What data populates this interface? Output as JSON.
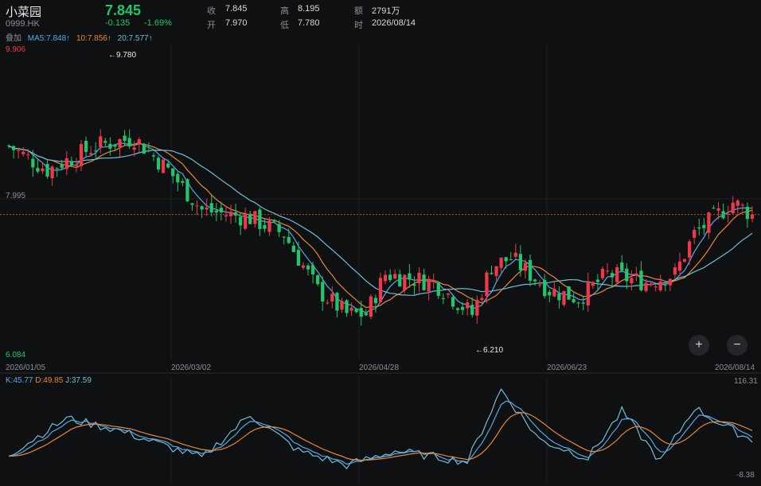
{
  "header": {
    "name": "小菜园",
    "code": "0999.HK",
    "price": "7.845",
    "change": "-0.135",
    "change_pct": "-1.69%",
    "close_label": "收",
    "close_value": "7.845",
    "open_label": "开",
    "open_value": "7.970",
    "high_label": "高",
    "high_value": "8.195",
    "low_label": "低",
    "low_value": "7.780",
    "amount_label": "额",
    "amount_value": "2791万",
    "time_label": "时",
    "time_value": "2026/08/14"
  },
  "ma_row": {
    "overlay_label": "叠加",
    "ma5": "MA5:7.848↑",
    "ma10": "10:7.856↑",
    "ma20": "20:7.577↑"
  },
  "price_axis": {
    "top": "9.906",
    "mid": "7.995",
    "bottom": "6.084",
    "max_marker": "←9.780",
    "min_marker": "←6.210"
  },
  "date_axis": [
    "2026/01/05",
    "2026/03/02",
    "2026/04/28",
    "2026/06/23",
    "2026/08/14"
  ],
  "kdj": {
    "k": "K:45.77",
    "d": "D:49.85",
    "j": "J:37.59",
    "top": "116.31",
    "bottom": "-8.38"
  },
  "controls": {
    "zoom_in": "+",
    "zoom_out": "−"
  },
  "colors": {
    "up": "#f0384a",
    "down": "#1fc66b",
    "ma5": "#5aa7e6",
    "ma10": "#e8873b",
    "ma20": "#6fbfd6",
    "k": "#5aa7e6",
    "d": "#e8873b",
    "j": "#6fbfd6",
    "top_price": "#f0384a",
    "bottom_price": "#1fc66b"
  },
  "chart_data": {
    "type": "candlestick",
    "title": "",
    "ylim": [
      6.084,
      9.906
    ],
    "last_price": 7.845,
    "anchors": [
      {
        "i": 0,
        "p": 8.7
      },
      {
        "i": 8,
        "p": 8.4
      },
      {
        "i": 18,
        "p": 8.7
      },
      {
        "i": 26,
        "p": 8.8
      },
      {
        "i": 33,
        "p": 8.4
      },
      {
        "i": 40,
        "p": 7.9
      },
      {
        "i": 50,
        "p": 7.8
      },
      {
        "i": 57,
        "p": 7.6
      },
      {
        "i": 64,
        "p": 6.9
      },
      {
        "i": 70,
        "p": 6.6
      },
      {
        "i": 74,
        "p": 6.6
      },
      {
        "i": 78,
        "p": 7.1
      },
      {
        "i": 88,
        "p": 7.0
      },
      {
        "i": 96,
        "p": 6.6
      },
      {
        "i": 100,
        "p": 7.2
      },
      {
        "i": 104,
        "p": 7.3
      },
      {
        "i": 112,
        "p": 6.9
      },
      {
        "i": 118,
        "p": 6.8
      },
      {
        "i": 124,
        "p": 7.1
      },
      {
        "i": 132,
        "p": 7.0
      },
      {
        "i": 138,
        "p": 7.1
      },
      {
        "i": 142,
        "p": 7.6
      },
      {
        "i": 150,
        "p": 8.0
      },
      {
        "i": 154,
        "p": 7.845
      }
    ],
    "kdj_anchors": [
      {
        "i": 0,
        "v": 20
      },
      {
        "i": 12,
        "v": 70
      },
      {
        "i": 22,
        "v": 55
      },
      {
        "i": 40,
        "v": 15
      },
      {
        "i": 50,
        "v": 75
      },
      {
        "i": 60,
        "v": 25
      },
      {
        "i": 70,
        "v": 5
      },
      {
        "i": 80,
        "v": 25
      },
      {
        "i": 95,
        "v": 10
      },
      {
        "i": 102,
        "v": 110
      },
      {
        "i": 110,
        "v": 40
      },
      {
        "i": 120,
        "v": 15
      },
      {
        "i": 127,
        "v": 80
      },
      {
        "i": 135,
        "v": 10
      },
      {
        "i": 142,
        "v": 85
      },
      {
        "i": 148,
        "v": 60
      },
      {
        "i": 154,
        "v": 40
      }
    ],
    "kdj_ylim": [
      -8.38,
      116.31
    ]
  }
}
